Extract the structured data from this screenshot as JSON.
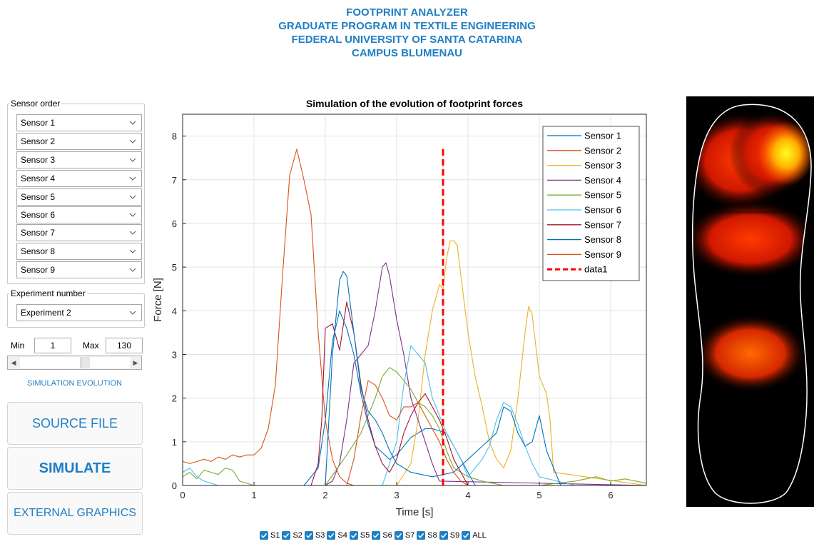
{
  "header": {
    "line1": "FOOTPRINT ANALYZER",
    "line2": "GRADUATE PROGRAM IN TEXTILE ENGINEERING",
    "line3": "FEDERAL UNIVERSITY OF SANTA CATARINA",
    "line4": "CAMPUS BLUMENAU"
  },
  "sensor_order": {
    "legend": "Sensor order",
    "options": [
      "Sensor 1",
      "Sensor 2",
      "Sensor 3",
      "Sensor 4",
      "Sensor 5",
      "Sensor 6",
      "Sensor 7",
      "Sensor 8",
      "Sensor 9"
    ]
  },
  "experiment": {
    "legend": "Experiment number",
    "selected": "Experiment 2"
  },
  "range": {
    "min_label": "Min",
    "min_value": "1",
    "max_label": "Max",
    "max_value": "130",
    "slider_position": 0.6
  },
  "simulation_evolution_label": "SIMULATION EVOLUTION",
  "buttons": {
    "source_file": "SOURCE FILE",
    "simulate": "SIMULATE",
    "external_graphics": "EXTERNAL GRAPHICS"
  },
  "checkboxes": [
    "S1",
    "S2",
    "S3",
    "S4",
    "S5",
    "S6",
    "S7",
    "S8",
    "S9",
    "ALL"
  ],
  "colors": {
    "accent": "#1f7fc4",
    "marker": "#ff0000"
  },
  "chart_data": {
    "type": "line",
    "title": "Simulation of the evolution of footprint forces",
    "xlabel": "Time [s]",
    "ylabel": "Force [N]",
    "xlim": [
      0,
      6.5
    ],
    "ylim": [
      0,
      8.5
    ],
    "xticks": [
      0,
      1,
      2,
      3,
      4,
      5,
      6
    ],
    "yticks": [
      0,
      1,
      2,
      3,
      4,
      5,
      6,
      7,
      8
    ],
    "grid": true,
    "legend_position": "top-right",
    "series": [
      {
        "name": "Sensor 1",
        "color": "#0072bd",
        "x": [
          0,
          1.7,
          1.9,
          2.0,
          2.1,
          2.2,
          2.3,
          2.4,
          2.5,
          2.6,
          2.7,
          2.9,
          3.0,
          3.2,
          3.4,
          3.5,
          3.6,
          3.7,
          3.8,
          3.9,
          4.0,
          4.1,
          6.5
        ],
        "y": [
          0,
          0,
          0.4,
          1.5,
          3.3,
          4.0,
          3.6,
          3.0,
          2.1,
          1.4,
          0.9,
          0.6,
          0.7,
          1.1,
          1.3,
          1.3,
          1.25,
          1.2,
          0.9,
          0.6,
          0.3,
          0,
          0
        ]
      },
      {
        "name": "Sensor 2",
        "color": "#d95319",
        "x": [
          0,
          0.1,
          0.2,
          0.3,
          0.4,
          0.5,
          0.6,
          0.7,
          0.8,
          0.9,
          1.0,
          1.1,
          1.2,
          1.3,
          1.4,
          1.5,
          1.6,
          1.7,
          1.8,
          1.9,
          2.0,
          2.1,
          2.2,
          2.3,
          2.4,
          6.5
        ],
        "y": [
          0.55,
          0.5,
          0.55,
          0.6,
          0.55,
          0.65,
          0.6,
          0.7,
          0.65,
          0.7,
          0.7,
          0.85,
          1.3,
          2.3,
          4.8,
          7.1,
          7.7,
          7.0,
          6.2,
          3.5,
          1.5,
          0.6,
          0.2,
          0.05,
          0,
          0
        ]
      },
      {
        "name": "Sensor 3",
        "color": "#edb120",
        "x": [
          0,
          3.0,
          3.2,
          3.3,
          3.4,
          3.5,
          3.6,
          3.65,
          3.7,
          3.75,
          3.8,
          3.85,
          3.9,
          4.0,
          4.1,
          4.2,
          4.3,
          4.4,
          4.5,
          4.6,
          4.7,
          4.8,
          4.85,
          4.9,
          5.0,
          5.1,
          5.15,
          5.2,
          6.5
        ],
        "y": [
          0,
          0,
          0.5,
          1.5,
          3.0,
          4.0,
          4.6,
          4.5,
          5.2,
          5.6,
          5.6,
          5.5,
          4.8,
          3.5,
          2.5,
          1.8,
          1.0,
          0.6,
          0.4,
          0.8,
          2.0,
          3.5,
          4.1,
          3.9,
          2.5,
          2.1,
          1.5,
          0.3,
          0
        ]
      },
      {
        "name": "Sensor 4",
        "color": "#7e2f8e",
        "x": [
          0,
          2.0,
          2.1,
          2.2,
          2.3,
          2.4,
          2.5,
          2.6,
          2.7,
          2.75,
          2.8,
          2.85,
          2.9,
          3.0,
          3.1,
          3.2,
          3.3,
          3.4,
          3.5,
          3.6,
          6.5
        ],
        "y": [
          0,
          0,
          0.1,
          0.5,
          1.5,
          2.8,
          3.0,
          3.2,
          4.0,
          4.5,
          5.0,
          5.1,
          4.8,
          3.8,
          3.0,
          2.0,
          1.5,
          1.0,
          0.5,
          0.1,
          0
        ]
      },
      {
        "name": "Sensor 5",
        "color": "#77ac30",
        "x": [
          0,
          0.1,
          0.2,
          0.3,
          0.4,
          0.5,
          0.6,
          0.7,
          0.8,
          1.0,
          2.0,
          2.3,
          2.5,
          2.7,
          2.8,
          2.9,
          3.0,
          3.1,
          3.2,
          3.3,
          3.4,
          3.5,
          3.6,
          3.7,
          3.8,
          4.0,
          4.2,
          4.5,
          4.8,
          5.0,
          5.5,
          5.8,
          6.0,
          6.2,
          6.5
        ],
        "y": [
          0.2,
          0.3,
          0.15,
          0.35,
          0.3,
          0.25,
          0.4,
          0.35,
          0.1,
          0,
          0,
          0.7,
          1.2,
          2.0,
          2.5,
          2.7,
          2.6,
          2.4,
          2.2,
          1.9,
          1.8,
          1.6,
          1.3,
          0.8,
          0.4,
          0.2,
          0.1,
          0,
          0,
          0,
          0.1,
          0.2,
          0.1,
          0.15,
          0.05
        ]
      },
      {
        "name": "Sensor 6",
        "color": "#4dbeee",
        "x": [
          0,
          0.1,
          0.2,
          0.3,
          0.5,
          2.8,
          3.0,
          3.1,
          3.2,
          3.3,
          3.4,
          3.5,
          3.6,
          3.7,
          3.8,
          3.9,
          4.0,
          4.1,
          4.2,
          4.3,
          4.4,
          4.5,
          4.6,
          4.7,
          4.8,
          4.9,
          5.0,
          5.5,
          6.5
        ],
        "y": [
          0.3,
          0.4,
          0.2,
          0.1,
          0,
          0,
          1.0,
          2.3,
          3.2,
          3.0,
          2.8,
          2.0,
          1.6,
          1.2,
          0.9,
          0.6,
          0.2,
          0.4,
          0.6,
          0.9,
          1.5,
          1.9,
          1.8,
          1.4,
          0.9,
          0.5,
          0.2,
          0,
          0
        ]
      },
      {
        "name": "Sensor 7",
        "color": "#a2142f",
        "x": [
          0,
          1.8,
          1.9,
          1.95,
          2.0,
          2.1,
          2.2,
          2.3,
          2.4,
          2.5,
          2.6,
          2.7,
          2.8,
          2.9,
          3.0,
          3.1,
          3.2,
          3.3,
          3.4,
          3.5,
          3.6,
          3.7,
          3.8,
          3.9,
          4.0,
          6.5
        ],
        "y": [
          0,
          0,
          0.5,
          1.5,
          3.6,
          3.7,
          3.1,
          4.2,
          3.5,
          2.3,
          1.5,
          0.9,
          0.5,
          0.3,
          0.6,
          1.2,
          1.6,
          1.9,
          2.1,
          1.8,
          1.5,
          1.1,
          0.6,
          0.3,
          0,
          0
        ]
      },
      {
        "name": "Sensor 8",
        "color": "#0072bd",
        "x": [
          0,
          2.0,
          2.1,
          2.2,
          2.25,
          2.3,
          2.4,
          2.5,
          2.6,
          2.7,
          2.8,
          2.9,
          3.0,
          3.2,
          3.5,
          3.8,
          4.0,
          4.2,
          4.4,
          4.5,
          4.6,
          4.7,
          4.8,
          4.9,
          5.0,
          5.1,
          5.3,
          6.5
        ],
        "y": [
          0,
          0,
          3.0,
          4.7,
          4.9,
          4.8,
          3.5,
          2.2,
          1.7,
          1.5,
          1.2,
          0.8,
          0.5,
          0.3,
          0.2,
          0.3,
          0.6,
          0.9,
          1.2,
          1.8,
          1.7,
          1.2,
          0.9,
          1.0,
          1.6,
          0.8,
          0,
          0
        ]
      },
      {
        "name": "Sensor 9",
        "color": "#d95319",
        "x": [
          0,
          2.3,
          2.4,
          2.5,
          2.6,
          2.7,
          2.8,
          2.9,
          3.0,
          3.1,
          3.2,
          3.3,
          3.4,
          3.5,
          3.6,
          3.7,
          3.8,
          3.9,
          4.0,
          6.5
        ],
        "y": [
          0,
          0,
          0.6,
          1.6,
          2.4,
          2.3,
          2.0,
          1.6,
          1.5,
          1.8,
          1.8,
          1.9,
          1.6,
          1.3,
          1.0,
          0.6,
          0.3,
          0.1,
          0,
          0
        ]
      },
      {
        "name": "data1",
        "color": "#ff0000",
        "dashed": true,
        "x": [
          3.65,
          3.65
        ],
        "y": [
          0,
          7.7
        ]
      }
    ]
  }
}
